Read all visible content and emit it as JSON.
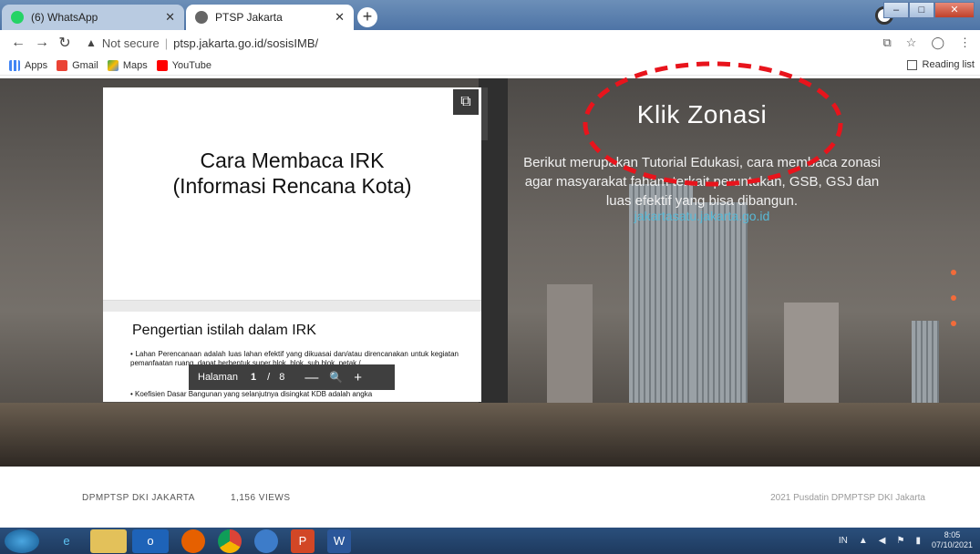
{
  "browser": {
    "tabs": [
      {
        "label": "(6) WhatsApp",
        "active": false,
        "favicon_color": "#25d366"
      },
      {
        "label": "PTSP Jakarta",
        "active": true,
        "favicon_color": "#555555"
      }
    ],
    "url_warning": "Not secure",
    "url": "ptsp.jakarta.go.id/sosisIMB/",
    "bookmarks": [
      {
        "label": "Apps",
        "icon": "apps-grid-icon"
      },
      {
        "label": "Gmail",
        "icon": "gmail-icon"
      },
      {
        "label": "Maps",
        "icon": "maps-icon"
      },
      {
        "label": "YouTube",
        "icon": "youtube-icon"
      }
    ],
    "reading_list": "Reading list"
  },
  "document": {
    "slide1_title_line1": "Cara Membaca IRK",
    "slide1_title_line2": "(Informasi Rencana Kota)",
    "slide2_heading": "Pengertian istilah dalam IRK",
    "slide2_para1": "• Lahan Perencanaan adalah luas lahan efektif yang dikuasai dan/atau direncanakan untuk kegiatan pemanfaatan ruang, dapat berbentuk super blok, blok, sub blok, petak / ...",
    "slide2_para2": "• Koefisien Dasar Bangunan yang selanjutnya disingkat KDB adalah angka",
    "pager": {
      "label": "Halaman",
      "current": "1",
      "separator": "/",
      "total": "8",
      "zoom_out": "—",
      "zoom_icon": "🔍",
      "zoom_in": "+"
    }
  },
  "hero": {
    "title": "Klik Zonasi",
    "description": "Berikut merupakan Tutorial Edukasi, cara membaca zonasi agar masyarakat faham terkait peruntukan, GSB, GSJ dan luas efektif yang bisa dibangun.",
    "link": "jakartasatu.jakarta.go.id",
    "annotation_color": "#e8141c"
  },
  "footer": {
    "org": "DPMPTSP DKI JAKARTA",
    "views": "1,156 VIEWS",
    "copyright": "2021 Pusdatin DPMPTSP DKI Jakarta"
  },
  "taskbar": {
    "apps": [
      "ie-icon",
      "explorer-icon",
      "outlook-icon",
      "firefox-icon",
      "chrome-icon",
      "chrome-alt-icon",
      "powerpoint-icon",
      "word-icon"
    ],
    "lang": "IN",
    "time": "8:05",
    "date": "07/10/2021"
  }
}
